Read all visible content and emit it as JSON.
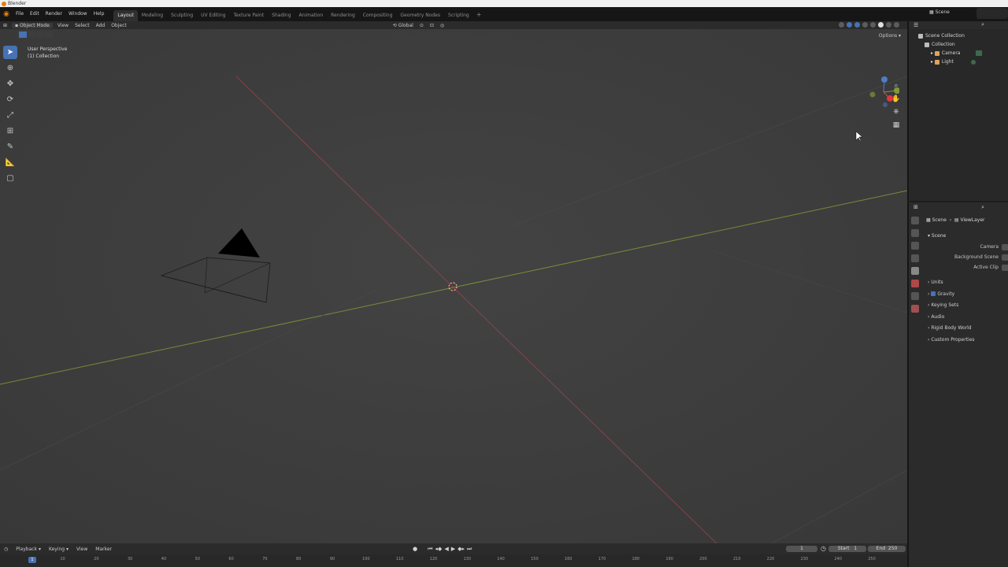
{
  "window": {
    "title": "Blender"
  },
  "menu": [
    "File",
    "Edit",
    "Render",
    "Window",
    "Help"
  ],
  "workspaces": [
    "Layout",
    "Modeling",
    "Sculpting",
    "UV Editing",
    "Texture Paint",
    "Shading",
    "Animation",
    "Rendering",
    "Compositing",
    "Geometry Nodes",
    "Scripting"
  ],
  "active_workspace": "Layout",
  "scene_name": "Scene",
  "viewport": {
    "mode": "Object Mode",
    "menus": [
      "View",
      "Select",
      "Add",
      "Object"
    ],
    "transform_orientation": "Global",
    "info_line1": "User Perspective",
    "info_line2": "(1) Collection",
    "options_label": "Options"
  },
  "outliner": {
    "rows": [
      {
        "label": "Scene Collection",
        "icon_color": "#c9c9c9"
      },
      {
        "label": "Collection",
        "icon_color": "#c9c9c9"
      },
      {
        "label": "Camera",
        "icon_color": "#e0a35a"
      },
      {
        "label": "Light",
        "icon_color": "#e0a35a"
      }
    ]
  },
  "properties": {
    "breadcrumb_scene": "Scene",
    "breadcrumb_layer": "ViewLayer",
    "panel_title": "Scene",
    "rows": [
      {
        "label": "Camera"
      },
      {
        "label": "Background Scene"
      },
      {
        "label": "Active Clip"
      }
    ],
    "subpanels": [
      "Units",
      "Gravity",
      "Keying Sets",
      "Audio",
      "Rigid Body World",
      "Custom Properties"
    ]
  },
  "timeline": {
    "menus": [
      "Playback",
      "Keying",
      "View",
      "Marker"
    ],
    "current_frame": "1",
    "current_frame_field": "1",
    "start_label": "Start",
    "start_value": "1",
    "end_label": "End",
    "end_value": "250",
    "ticks": [
      "10",
      "20",
      "30",
      "40",
      "50",
      "60",
      "70",
      "80",
      "90",
      "100",
      "110",
      "120",
      "130",
      "140",
      "150",
      "160",
      "170",
      "180",
      "190",
      "200",
      "210",
      "220",
      "230",
      "240",
      "250"
    ]
  },
  "colors": {
    "accent": "#4772b3",
    "x_axis": "#a3454e",
    "y_axis": "#7f9a3a"
  }
}
